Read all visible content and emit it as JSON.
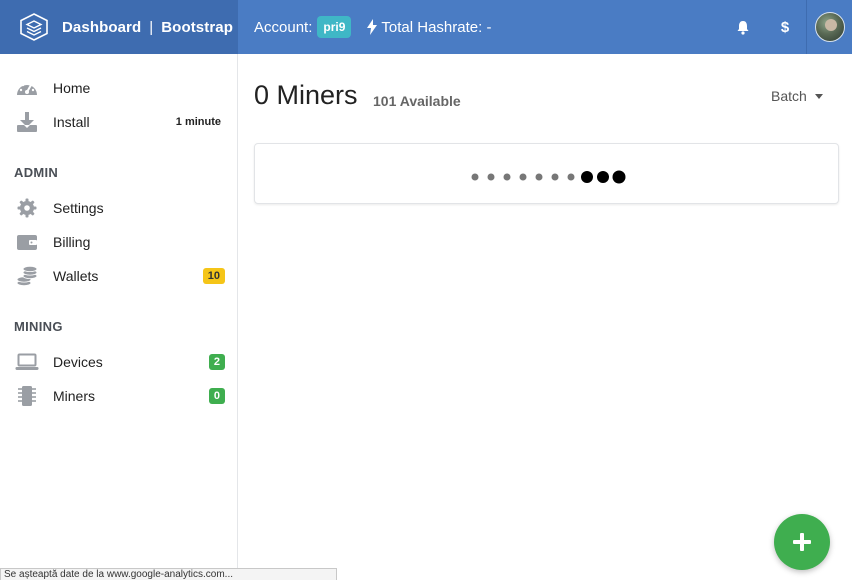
{
  "header": {
    "brand_name": "Dashboard",
    "brand_separator": "|",
    "brand_suffix": "Bootstrap",
    "account_label": "Account:",
    "account_name": "pri9",
    "hashrate_label": "Total Hashrate: -",
    "dollar_glyph": "$",
    "colors": {
      "topbar": "#4a7cc4",
      "brand_bg": "#3e6cb0",
      "account_badge": "#3fb7c6"
    }
  },
  "sidebar": {
    "top_items": [
      {
        "label": "Home",
        "icon": "dashboard-gauge-icon"
      },
      {
        "label": "Install",
        "icon": "download-icon",
        "meta": "1 minute"
      }
    ],
    "admin": {
      "title": "ADMIN",
      "items": [
        {
          "label": "Settings",
          "icon": "gear-icon"
        },
        {
          "label": "Billing",
          "icon": "wallet-icon"
        },
        {
          "label": "Wallets",
          "icon": "coins-stack-icon",
          "badge": "10"
        }
      ]
    },
    "mining": {
      "title": "MINING",
      "items": [
        {
          "label": "Devices",
          "icon": "laptop-icon",
          "badge": "2"
        },
        {
          "label": "Miners",
          "icon": "chip-icon",
          "badge": "0"
        }
      ]
    },
    "colors": {
      "badge_yellow": "#f5c518",
      "badge_green": "#3fae4f"
    }
  },
  "main": {
    "title": "0 Miners",
    "available": "101 Available",
    "batch_label": "Batch",
    "loader_dots": 10
  },
  "fab": {
    "icon": "plus-icon",
    "color": "#3fae4f"
  },
  "statusbar": {
    "text": "Se așteaptă date de la www.google-analytics.com..."
  }
}
